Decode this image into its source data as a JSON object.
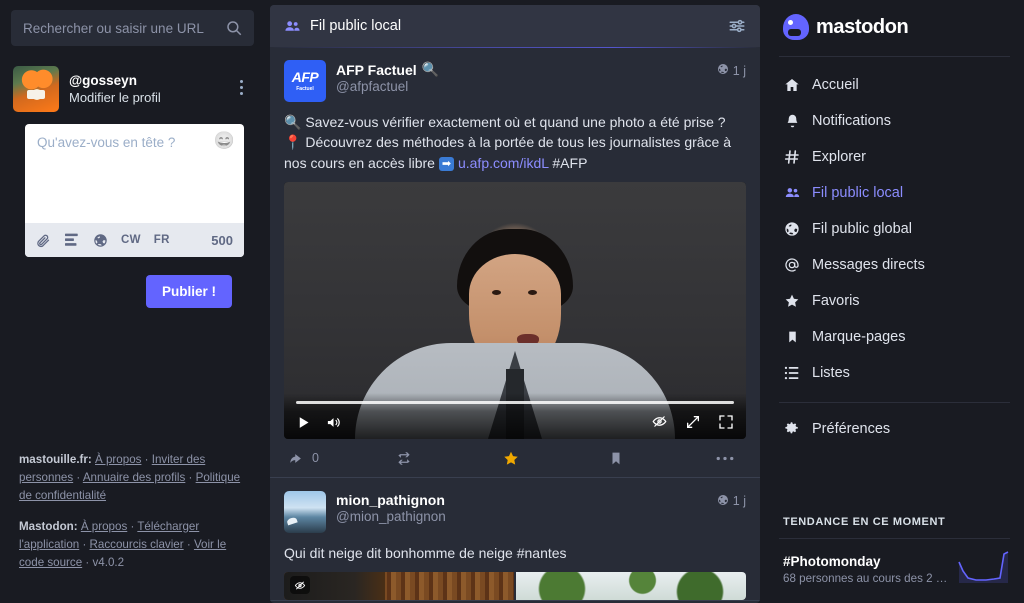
{
  "left": {
    "search": {
      "placeholder": "Rechercher ou saisir une URL",
      "icon": "search-icon"
    },
    "profile": {
      "handle": "@gosseyn",
      "edit_label": "Modifier le profil"
    },
    "compose": {
      "placeholder": "Qu'avez-vous en tête ?",
      "emoji_icon": "smiley-icon",
      "attach_icon": "paperclip-icon",
      "poll_icon": "poll-icon",
      "visibility_icon": "globe-icon",
      "cw_label": "CW",
      "language_label": "FR",
      "char_count": "500",
      "publish_label": "Publier !"
    },
    "footer": {
      "instance_label": "mastouille.fr:",
      "instance_links": [
        "À propos",
        "Inviter des personnes",
        "Annuaire des profils",
        "Politique de confidentialité"
      ],
      "app_label": "Mastodon:",
      "app_links": [
        "À propos",
        "Télécharger l'application",
        "Raccourcis clavier",
        "Voir le code source"
      ],
      "version": "v4.0.2",
      "separator": " · "
    }
  },
  "main": {
    "header": {
      "title": "Fil public local",
      "icon": "users-icon",
      "settings_icon": "sliders-icon"
    },
    "statuses": [
      {
        "display_name": "AFP Factuel",
        "display_emoji": "🔍",
        "acct": "@afpfactuel",
        "timestamp": "1 j",
        "visibility_icon": "globe-icon",
        "avatar": "afp-logo",
        "avatar_text": "AFP",
        "avatar_subtext": "Factuel",
        "body_line1_emoji": "🔍",
        "body_line1": "Savez-vous vérifier exactement où et quand une photo a été prise ?",
        "body_line2_emoji": "📍",
        "body_line2": "Découvrez des méthodes à la portée de tous les journalistes grâce à nos cours en accès libre",
        "body_arrow": "➡",
        "body_link": "u.afp.com/ikdL",
        "body_hashtag": "#AFP",
        "media_type": "video",
        "video_controls": {
          "play_icon": "play-icon",
          "volume_icon": "volume-icon",
          "hide_icon": "eye-slash-icon",
          "expand_icon": "expand-icon",
          "fullscreen_icon": "fullscreen-icon"
        },
        "actions": {
          "reply_icon": "reply-icon",
          "reply_count": "0",
          "boost_icon": "boost-icon",
          "favourite_icon": "star-icon",
          "bookmark_icon": "bookmark-icon",
          "more_icon": "ellipsis-icon"
        }
      },
      {
        "display_name": "mion_pathignon",
        "acct": "@mion_pathignon",
        "timestamp": "1 j",
        "visibility_icon": "globe-icon",
        "avatar": "sky-photo",
        "body": "Qui dit neige dit bonhomme de neige #nantes",
        "media_type": "images",
        "media_hide_icon": "eye-slash-icon"
      }
    ]
  },
  "right": {
    "brand": "mastodon",
    "nav": [
      {
        "label": "Accueil",
        "icon": "home-icon",
        "active": false
      },
      {
        "label": "Notifications",
        "icon": "bell-icon",
        "active": false
      },
      {
        "label": "Explorer",
        "icon": "hashtag-icon",
        "active": false
      },
      {
        "label": "Fil public local",
        "icon": "users-icon",
        "active": true
      },
      {
        "label": "Fil public global",
        "icon": "globe-icon",
        "active": false
      },
      {
        "label": "Messages directs",
        "icon": "at-icon",
        "active": false
      },
      {
        "label": "Favoris",
        "icon": "star-icon",
        "active": false
      },
      {
        "label": "Marque-pages",
        "icon": "bookmark-icon",
        "active": false
      },
      {
        "label": "Listes",
        "icon": "list-icon",
        "active": false
      }
    ],
    "preferences": {
      "label": "Préférences",
      "icon": "gear-icon"
    },
    "trends": {
      "title": "TENDANCE EN CE MOMENT",
      "items": [
        {
          "tag": "#Photomonday",
          "subtitle": "68 personnes au cours des 2 der…"
        }
      ]
    }
  },
  "colors": {
    "accent": "#6364ff",
    "accent_text": "#8c8dff",
    "app_bg": "#191b22",
    "column_bg": "#282c37",
    "header_bg": "#313543",
    "muted_text": "#8d93a8",
    "star_gold": "#f0a800"
  }
}
